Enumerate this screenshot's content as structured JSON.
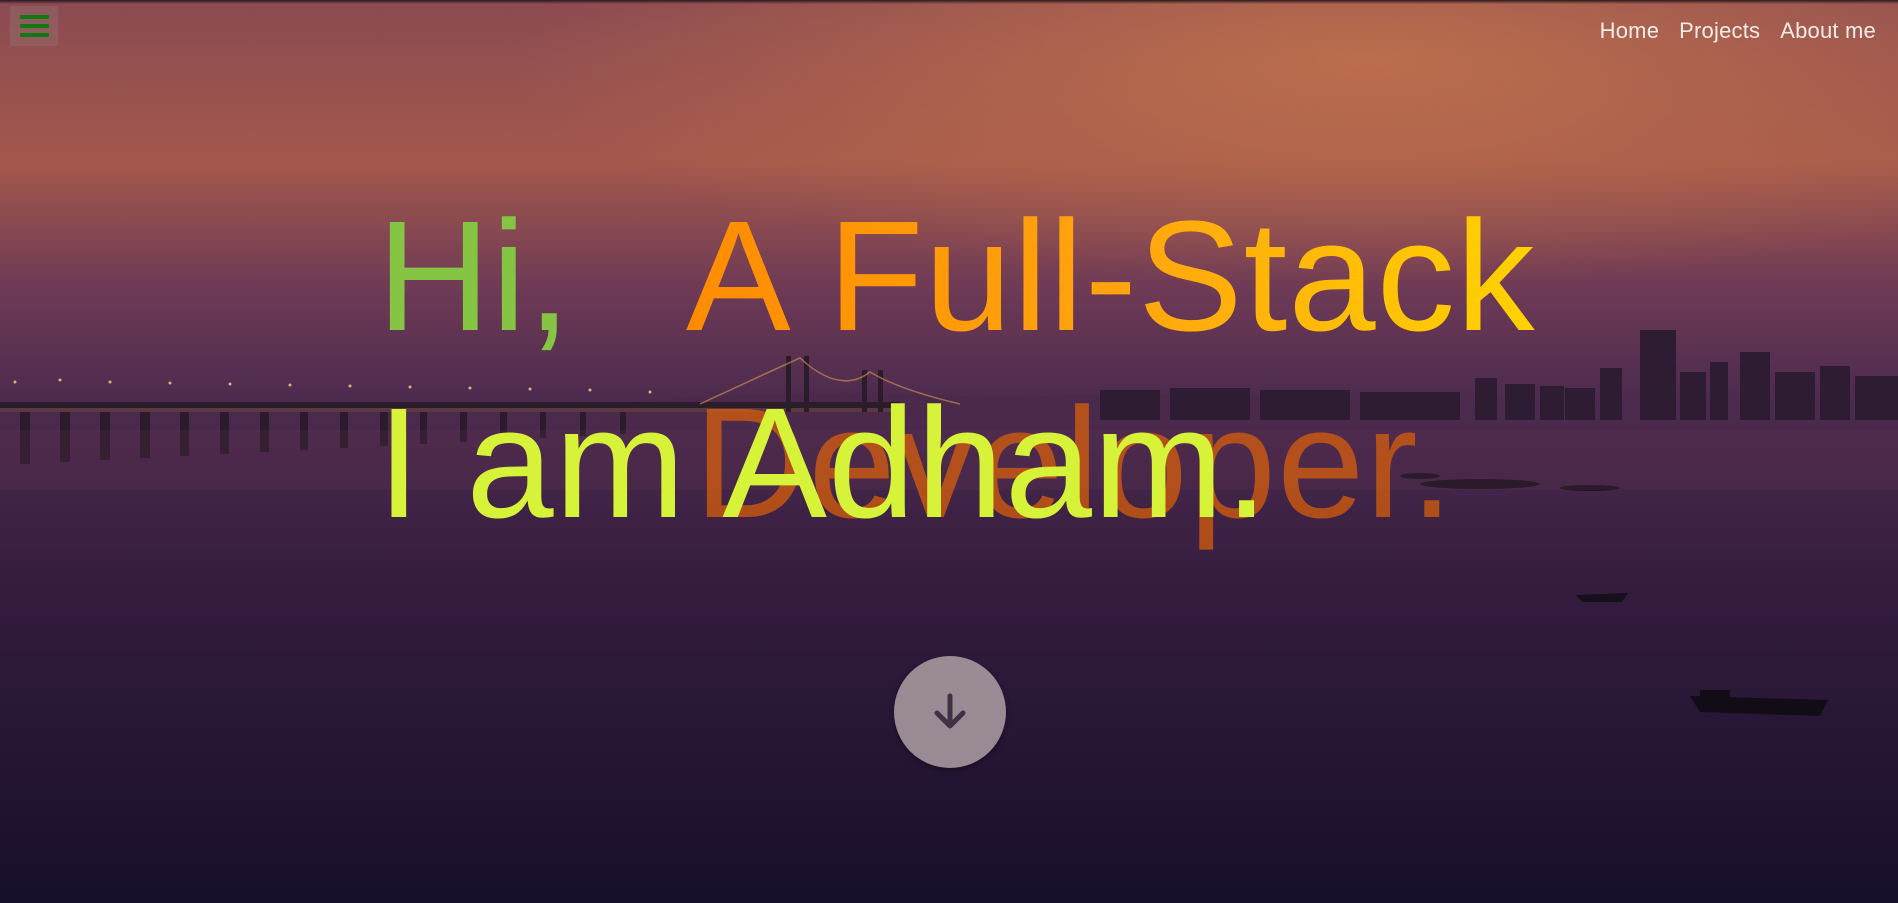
{
  "header": {
    "menu_icon": "hamburger-menu-icon",
    "menu_icon_color": "#0f7a12",
    "nav": [
      {
        "label": "Home"
      },
      {
        "label": "Projects"
      },
      {
        "label": "About me"
      }
    ]
  },
  "hero": {
    "greeting_line1": "Hi,",
    "greeting_line2": "I am Adham.",
    "role_line1": "A Full-Stack",
    "role_line2": "Developer.",
    "colors": {
      "greeting_line1": "#86c443",
      "greeting_line2": "#d6f33a",
      "role_start": "#ff8c00",
      "role_end": "#ffd200",
      "role_line2": "#dc5f0a"
    }
  },
  "scroll_button": {
    "icon": "arrow-down-icon"
  }
}
